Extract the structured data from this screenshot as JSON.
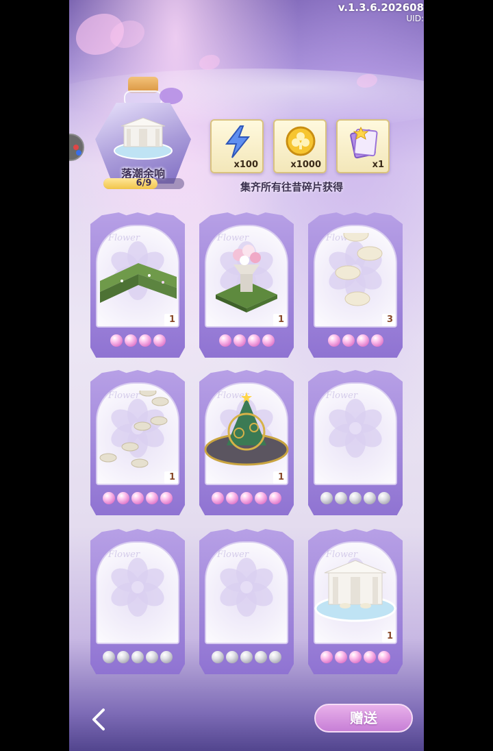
{
  "status": {
    "version": "v.1.3.6.202608",
    "uid": "UID:"
  },
  "colors": {
    "accent": "#9a7bd8",
    "pearl_filled": "#e07acb",
    "pearl_empty": "#a7a7b2",
    "button": "#c77fd6"
  },
  "collection": {
    "title": "落潮余响",
    "progress_text": "6/9",
    "collected": 6,
    "total": 9
  },
  "rewards": {
    "items": [
      {
        "icon": "lightning-icon",
        "qty": "x100"
      },
      {
        "icon": "gold-coin-icon",
        "qty": "x1000"
      },
      {
        "icon": "card-pack-icon",
        "qty": "x1"
      }
    ],
    "caption": "集齐所有往昔碎片获得"
  },
  "cards": [
    {
      "item": "hedge-corner",
      "count": "1",
      "stars": 4,
      "owned": true
    },
    {
      "item": "flower-urn-planter",
      "count": "1",
      "stars": 4,
      "owned": true
    },
    {
      "item": "stepping-stones",
      "count": "3",
      "stars": 4,
      "owned": true
    },
    {
      "item": "pebble-path",
      "count": "1",
      "stars": 5,
      "owned": true
    },
    {
      "item": "armillary-sphere-tree",
      "count": "1",
      "stars": 5,
      "owned": true
    },
    {
      "item": "locked-flower",
      "count": "",
      "stars": 5,
      "owned": false
    },
    {
      "item": "locked-flower",
      "count": "",
      "stars": 5,
      "owned": false
    },
    {
      "item": "locked-flower",
      "count": "",
      "stars": 5,
      "owned": false
    },
    {
      "item": "fountain",
      "count": "1",
      "stars": 5,
      "owned": true
    }
  ],
  "card_watermark": "Flower",
  "footer": {
    "gift_label": "赠送",
    "back_icon": "chevron-left-icon"
  }
}
